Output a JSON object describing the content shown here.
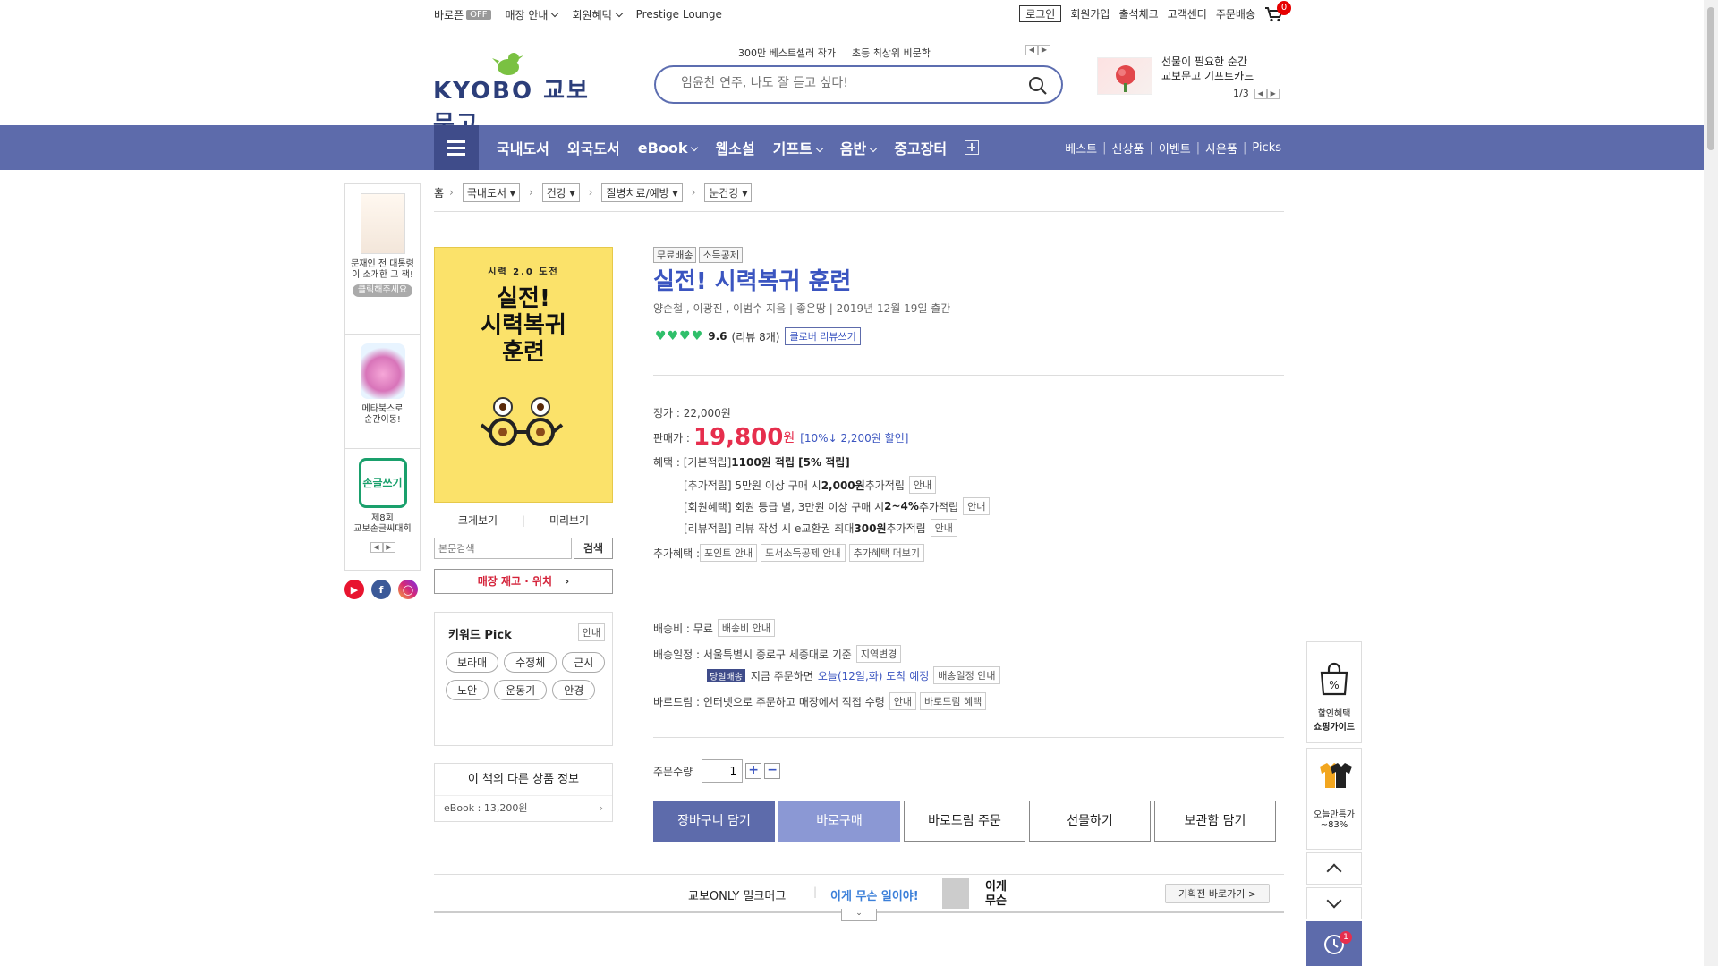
{
  "topbar": {
    "baroreturn_label": "바로픈",
    "baroreturn_state": "OFF",
    "store_info": "매장 안내",
    "member_benefit": "회원혜택",
    "prestige": "Prestige Lounge",
    "login": "로그인",
    "signup": "회원가입",
    "attendance": "출석체크",
    "customer_center": "고객센터",
    "order_delivery": "주문배송",
    "cart_count": "0"
  },
  "header": {
    "logo_text": "KYOBO 교보문고",
    "search_keywords": [
      "300만 베스트셀러 작가",
      "초등 최상위 비문학"
    ],
    "search_placeholder": "임윤찬 연주, 나도 잘 듣고 싶다!",
    "gift_line1": "선물이 필요한 순간",
    "gift_line2": "교보문고 기프트카드",
    "gift_page": "1/3"
  },
  "nav": {
    "items": [
      "국내도서",
      "외국도서",
      "eBook",
      "웹소설",
      "기프트",
      "음반",
      "중고장터"
    ],
    "right": [
      "베스트",
      "신상품",
      "이벤트",
      "사은품",
      "Picks"
    ]
  },
  "left_banners": [
    {
      "line1": "문재인 전 대통령",
      "line2": "이 소개한 그 책!",
      "cta": "클릭해주세요"
    },
    {
      "line1": "메타북스로",
      "line2": "순간이동!"
    },
    {
      "logo": "손글쓰기",
      "line1": "제8회",
      "line2": "교보손글씨대회"
    }
  ],
  "breadcrumb": {
    "home": "홈",
    "levels": [
      "국내도서",
      "건강",
      "질병치료/예방",
      "눈건강"
    ]
  },
  "cover": {
    "top": "시력 2.0 도전",
    "title_l1": "실전!",
    "title_l2": "시력복귀",
    "title_l3": "훈련"
  },
  "left_col": {
    "zoom": "크게보기",
    "preview": "미리보기",
    "body_search_placeholder": "본문검색",
    "search_btn": "검색",
    "store_stock": "매장 재고 · 위치",
    "keyword_title": "키워드 Pick",
    "keyword_info": "안내",
    "keywords": [
      "보라매",
      "수정체",
      "근시",
      "노안",
      "운동기",
      "안경"
    ],
    "other_title": "이 책의 다른 상품 정보",
    "other_ebook": "eBook : 13,200원"
  },
  "product": {
    "tags": [
      "무료배송",
      "소득공제"
    ],
    "title": "실전! 시력복귀 훈련",
    "authors": "양순철 , 이광진 , 이범수 지음 | 좋은땅 | 2019년 12월 19일 출간",
    "rating": "9.6",
    "reviews": "(리뷰 8개)",
    "review_btn": "클로버 리뷰쓰기",
    "list_price": "정가 : 22,000원",
    "sale_label": "판매가 : ",
    "sale_price": "19,800",
    "won": "원",
    "discount": "[10%↓ 2,200원 할인]",
    "benefit_label": "혜택 : [기본적립] ",
    "benefit_base": "1100원 적립 [5% 적립]",
    "extra1_pre": "[추가적립] 5만원 이상 구매 시 ",
    "extra1_val": "2,000원",
    "extra1_post": " 추가적립",
    "extra2_pre": "[회원혜택] 회원 등급 별, 3만원 이상 구매 시 ",
    "extra2_val": "2~4%",
    "extra2_post": " 추가적립",
    "extra3_pre": "[리뷰적립] 리뷰 작성 시 e교환권 최대 ",
    "extra3_val": "300원",
    "extra3_post": " 추가적립",
    "info": "안내",
    "extra_label": "추가혜택 : ",
    "extra_btns": [
      "포인트 안내",
      "도서소득공제 안내",
      "추가혜택 더보기"
    ],
    "ship_fee": "배송비 : 무료",
    "ship_info": "배송비 안내",
    "ship_schedule": "배송일정 : 서울특별시 종로구 세종대로 기준",
    "region_change": "지역변경",
    "same_day": "당일배송",
    "order_now": "지금 주문하면",
    "arrival": "오늘(12일,화) 도착 예정",
    "schedule_info": "배송일정 안내",
    "barodrim": "바로드림 : 인터넷으로 주문하고 매장에서 직접 수령",
    "barodrim_benefit": "바로드림 혜택",
    "qty_label": "주문수량",
    "qty": "1"
  },
  "actions": [
    "장바구니 담기",
    "바로구매",
    "바로드림 주문",
    "선물하기",
    "보관함 담기"
  ],
  "bottom_banner": {
    "t1": "교보ONLY 밀크머그",
    "t2": "이게 무슨 일이야!",
    "t3a": "이게",
    "t3b": "무슨",
    "btn": "기획전 바로가기 >"
  },
  "right_float": {
    "guide_l1": "할인혜택",
    "guide_l2": "쇼핑가이드",
    "deal_l1": "오늘만특가",
    "deal_l2": "~83%",
    "recent_count": "1"
  }
}
